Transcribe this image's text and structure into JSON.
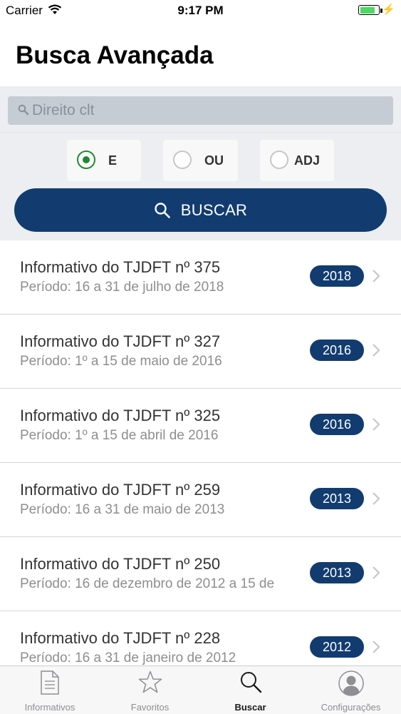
{
  "status_bar": {
    "carrier": "Carrier",
    "time": "9:17 PM",
    "battery_level": 0.75
  },
  "page_title": "Busca Avançada",
  "search": {
    "placeholder": "Direito clt",
    "value": ""
  },
  "operators": [
    {
      "label": "E",
      "selected": true
    },
    {
      "label": "OU",
      "selected": false
    },
    {
      "label": "ADJ",
      "selected": false
    }
  ],
  "buscar_label": "BUSCAR",
  "results": [
    {
      "title": "Informativo do TJDFT nº 375",
      "period": "Período: 16 a 31 de julho de 2018",
      "year": "2018"
    },
    {
      "title": "Informativo do TJDFT nº 327",
      "period": "Período: 1º a 15 de maio de 2016",
      "year": "2016"
    },
    {
      "title": "Informativo do TJDFT nº 325",
      "period": "Período: 1º a 15 de abril de 2016",
      "year": "2016"
    },
    {
      "title": "Informativo do TJDFT nº 259",
      "period": "Período: 16 a 31 de maio de 2013",
      "year": "2013"
    },
    {
      "title": "Informativo do TJDFT nº 250",
      "period": "Período: 16 de dezembro de 2012 a 15 de",
      "year": "2013"
    },
    {
      "title": "Informativo do TJDFT nº 228",
      "period": "Período: 16 a 31 de janeiro de 2012",
      "year": "2012"
    }
  ],
  "tabs": [
    {
      "label": "Informativos",
      "icon": "document-icon",
      "active": false
    },
    {
      "label": "Favoritos",
      "icon": "star-icon",
      "active": false
    },
    {
      "label": "Buscar",
      "icon": "search-icon",
      "active": true
    },
    {
      "label": "Configurações",
      "icon": "user-icon",
      "active": false
    }
  ],
  "colors": {
    "navy": "#123c70",
    "radio_selected": "#1e8a2e",
    "battery": "#4cd964"
  }
}
